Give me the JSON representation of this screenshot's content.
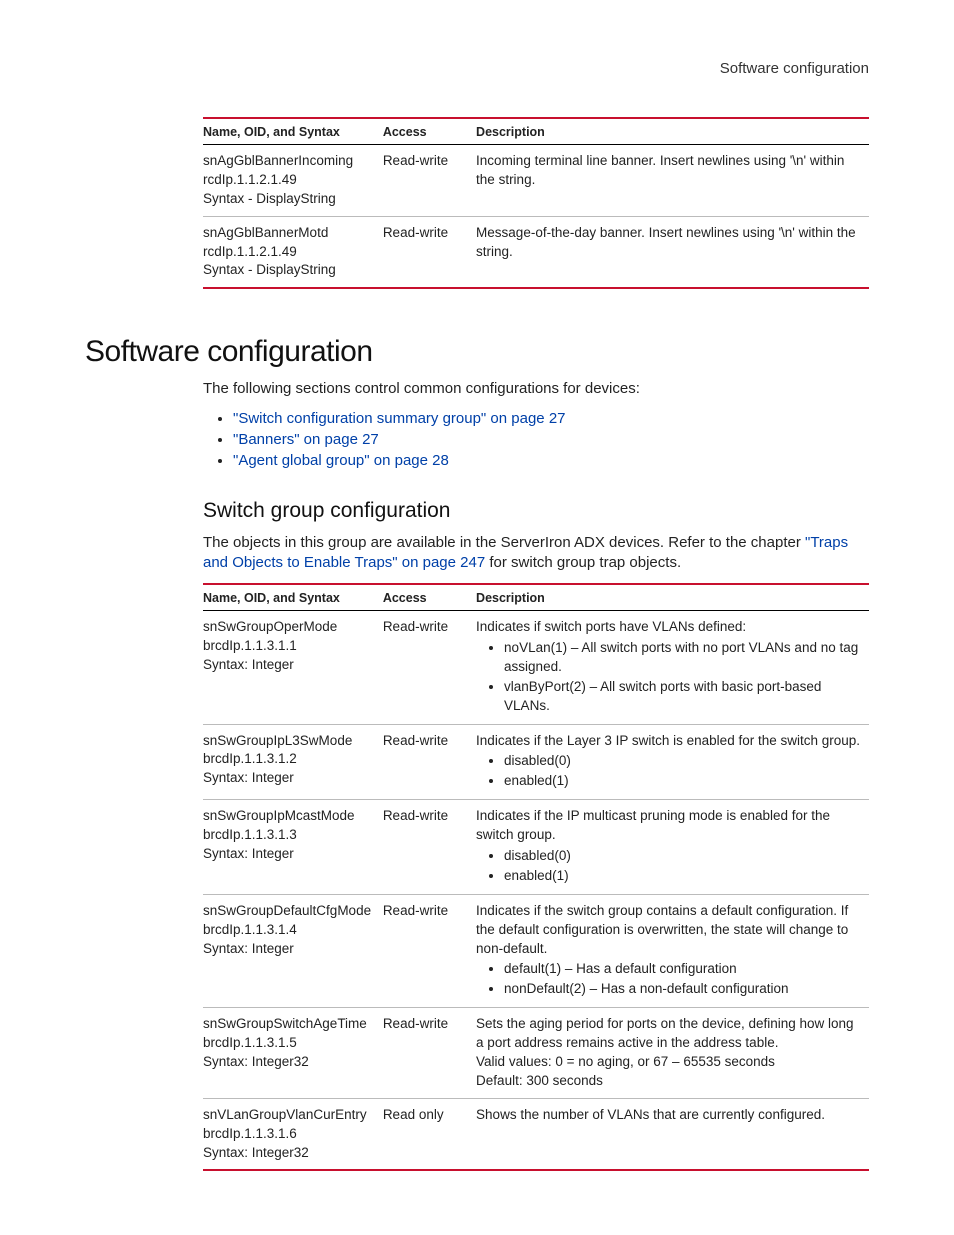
{
  "running_header": "Software configuration",
  "table1": {
    "headers": {
      "nos": "Name, OID, and Syntax",
      "access": "Access",
      "desc": "Description"
    },
    "rows": [
      {
        "name": "snAgGblBannerIncoming",
        "oid": "rcdIp.1.1.2.1.49",
        "syntax": "Syntax - DisplayString",
        "access": "Read-write",
        "desc_intro": "Incoming terminal line banner. Insert newlines using '\\n' within the string."
      },
      {
        "name": "snAgGblBannerMotd",
        "oid": "rcdIp.1.1.2.1.49",
        "syntax": "Syntax - DisplayString",
        "access": "Read-write",
        "desc_intro": "Message-of-the-day banner. Insert newlines using '\\n' within the string."
      }
    ]
  },
  "section_heading": "Software configuration",
  "section_intro": "The following sections control common configurations for devices:",
  "section_links": [
    "\"Switch configuration summary group\" on page 27",
    "\"Banners\" on page 27",
    "\"Agent global group\" on page 28"
  ],
  "subsection_heading": "Switch group configuration",
  "sub_intro_pre": "The objects in this group are available in the ServerIron ADX devices. Refer to the chapter ",
  "sub_intro_link": "\"Traps and Objects to Enable Traps\" on page 247",
  "sub_intro_post": " for switch group trap objects.",
  "table2": {
    "headers": {
      "nos": "Name, OID, and Syntax",
      "access": "Access",
      "desc": "Description"
    },
    "rows": [
      {
        "name": "snSwGroupOperMode",
        "oid": "brcdIp.1.1.3.1.1",
        "syntax": "Syntax: Integer",
        "access": "Read-write",
        "desc_intro": "Indicates if switch ports have VLANs defined:",
        "bullets": [
          "noVLan(1) – All switch ports with no port VLANs and no tag assigned.",
          "vlanByPort(2) – All switch ports with basic port-based VLANs."
        ]
      },
      {
        "name": "snSwGroupIpL3SwMode",
        "oid": "brcdIp.1.1.3.1.2",
        "syntax": "Syntax: Integer",
        "access": "Read-write",
        "desc_intro": "Indicates if the Layer 3 IP switch is enabled for the switch group.",
        "bullets": [
          "disabled(0)",
          "enabled(1)"
        ]
      },
      {
        "name": "snSwGroupIpMcastMode",
        "oid": "brcdIp.1.1.3.1.3",
        "syntax": "Syntax: Integer",
        "access": "Read-write",
        "desc_intro": "Indicates if the IP multicast pruning mode is enabled for the switch group.",
        "bullets": [
          "disabled(0)",
          "enabled(1)"
        ]
      },
      {
        "name": "snSwGroupDefaultCfgMode",
        "oid": "brcdIp.1.1.3.1.4",
        "syntax": "Syntax: Integer",
        "access": "Read-write",
        "desc_intro": "Indicates if the switch group contains a default configuration. If the default configuration is overwritten, the state will change to non-default.",
        "bullets": [
          "default(1) – Has a default configuration",
          "nonDefault(2) – Has a non-default configuration"
        ]
      },
      {
        "name": "snSwGroupSwitchAgeTime",
        "oid": "brcdIp.1.1.3.1.5",
        "syntax": "Syntax: Integer32",
        "access": "Read-write",
        "desc_intro": "Sets the aging period for ports on the device, defining how long a port address remains active in the address table.",
        "extra": [
          "Valid values: 0 = no aging, or 67 – 65535 seconds",
          "Default: 300 seconds"
        ]
      },
      {
        "name": "snVLanGroupVlanCurEntry",
        "oid": "brcdIp.1.1.3.1.6",
        "syntax": "Syntax: Integer32",
        "access": "Read only",
        "desc_intro": "Shows the number of VLANs that are currently configured."
      }
    ]
  }
}
